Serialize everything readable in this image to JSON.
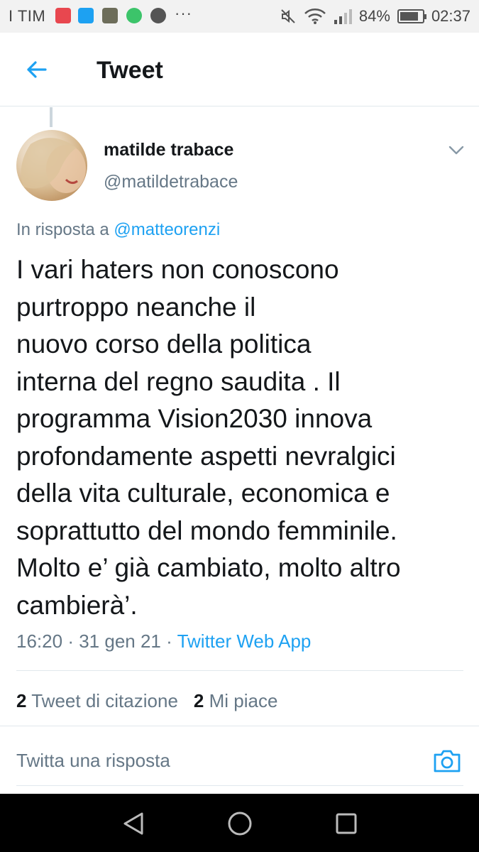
{
  "status_bar": {
    "carrier": "I TIM",
    "more_notifications": "···",
    "battery_percent": "84%",
    "battery_level": 0.84,
    "time": "02:37",
    "notification_icons": [
      "tim-app-icon",
      "twitter-icon",
      "photo-icon",
      "whatsapp-icon",
      "app-icon"
    ]
  },
  "header": {
    "title": "Tweet"
  },
  "tweet": {
    "author_name": "matilde trabace",
    "author_handle": "@matildetrabace",
    "reply_prefix": "In risposta a",
    "reply_to": "@matteorenzi",
    "text": "I vari haters non conoscono\npurtroppo neanche il\nnuovo corso della politica\ninterna del regno saudita . Il\nprogramma Vision2030 innova\nprofondamente aspetti nevralgici\ndella vita culturale, economica e\nsoprattutto del mondo femminile.\nMolto e’ già cambiato, molto altro\ncambierà’.",
    "time": "16:20",
    "date": "31 gen 21",
    "separator": "·",
    "source": "Twitter Web App"
  },
  "stats": {
    "quotes_count": "2",
    "quotes_label": "Tweet di citazione",
    "likes_count": "2",
    "likes_label": "Mi piace"
  },
  "reply_box": {
    "placeholder": "Twitta una risposta"
  },
  "colors": {
    "accent": "#1da1f2",
    "text": "#14171a",
    "secondary": "#657786",
    "divider": "#e1e8ed"
  }
}
